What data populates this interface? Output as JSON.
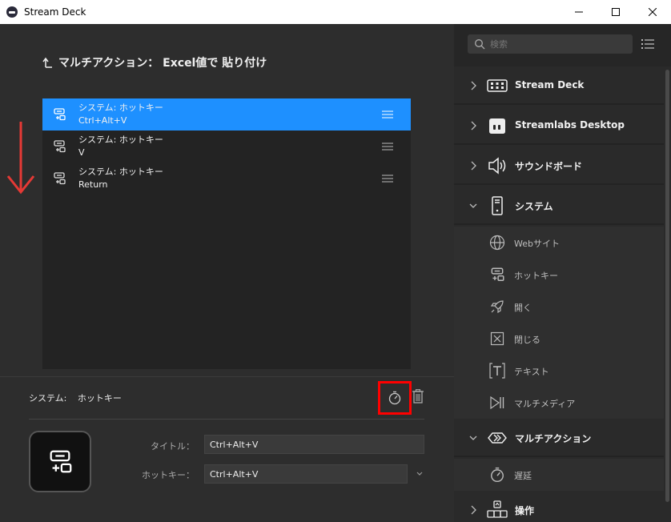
{
  "window": {
    "title": "Stream Deck"
  },
  "editor": {
    "title": "マルチアクション： Excel値で 貼り付け",
    "actions": [
      {
        "line1": "システム: ホットキー",
        "line2": "Ctrl+Alt+V",
        "selected": true
      },
      {
        "line1": "システム: ホットキー",
        "line2": "V",
        "selected": false
      },
      {
        "line1": "システム: ホットキー",
        "line2": "Return",
        "selected": false
      }
    ]
  },
  "props": {
    "category": "システム:",
    "action": "ホットキー",
    "title_label": "タイトル：",
    "title_value": "Ctrl+Alt+V",
    "hotkey_label": "ホットキー：",
    "hotkey_value": "Ctrl+Alt+V"
  },
  "sidebar": {
    "search_placeholder": "検索",
    "categories": {
      "streamdeck": "Stream Deck",
      "streamlabs": "Streamlabs Desktop",
      "soundboard": "サウンドボード",
      "system": "システム",
      "multiaction": "マルチアクション",
      "operation": "操作"
    },
    "system_items": {
      "website": "Webサイト",
      "hotkey": "ホットキー",
      "open": "開く",
      "close": "閉じる",
      "text": "テキスト",
      "multimedia": "マルチメディア"
    },
    "multiaction_items": {
      "delay": "遅延"
    }
  },
  "colors": {
    "accent": "#1e90ff",
    "highlight": "#ff0000",
    "background": "#2d2d2d"
  }
}
